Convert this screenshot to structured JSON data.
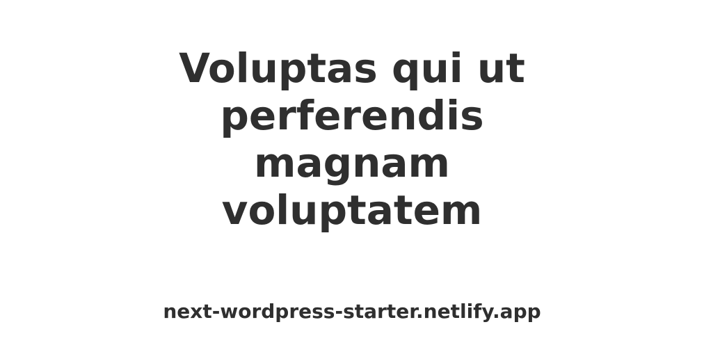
{
  "card": {
    "title": "Voluptas qui ut perferendis magnam voluptatem",
    "site_url": "next-wordpress-starter.netlify.app",
    "text_color": "#2f2f2f",
    "background_color": "#ffffff"
  }
}
